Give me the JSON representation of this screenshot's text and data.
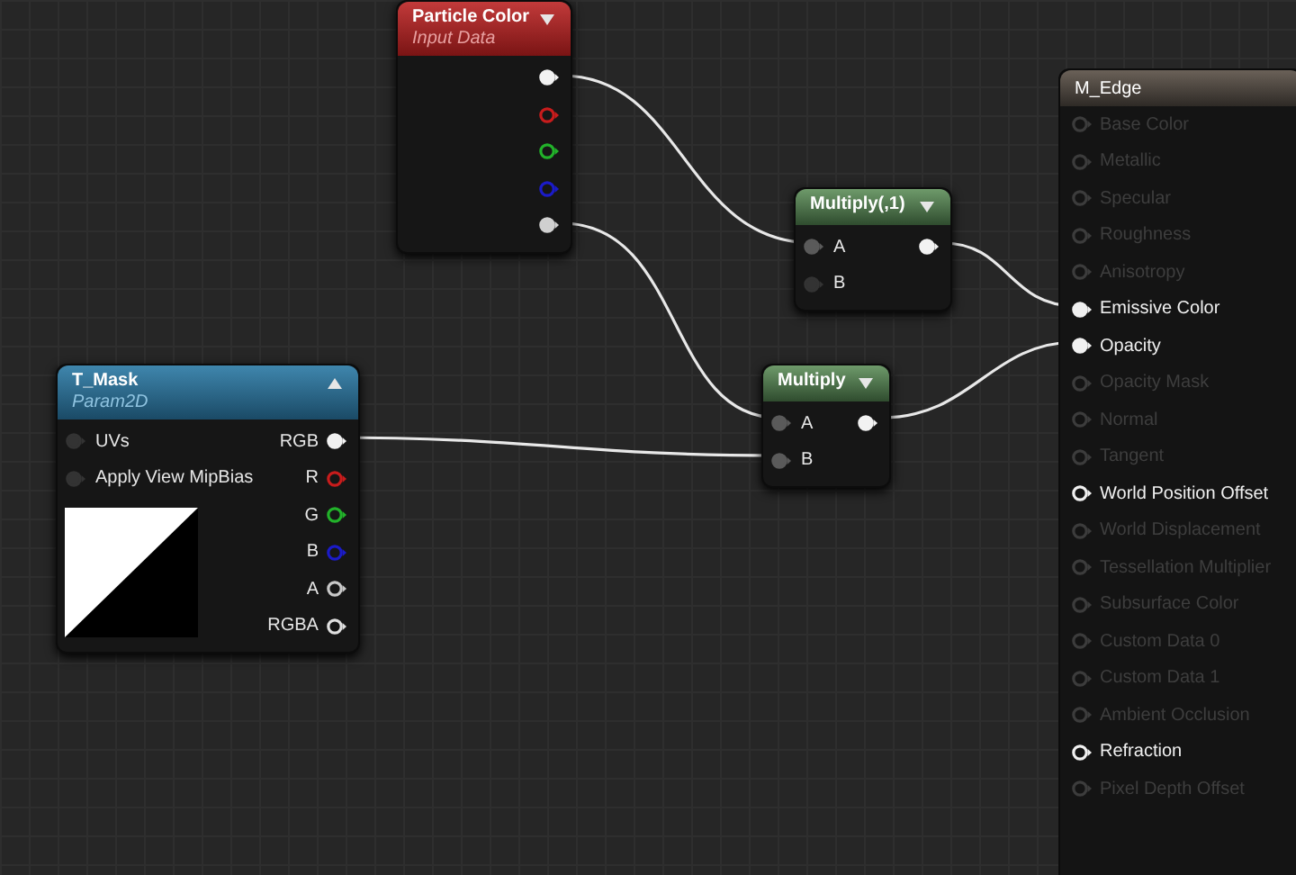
{
  "nodes": [
    {
      "kind": "particle",
      "title": "Particle Color",
      "subtitle": "Input Data",
      "preview_shown": false,
      "outputs": [
        {
          "color": "#f2f2f2",
          "connected": true
        },
        {
          "color": "#c81c1c",
          "connected": false
        },
        {
          "color": "#22b22a",
          "connected": false
        },
        {
          "color": "#1b1bc8",
          "connected": false
        },
        {
          "color": "#d0d0d0",
          "connected": true
        }
      ]
    },
    {
      "kind": "math",
      "title": "Multiply(,1)",
      "preview_shown": false,
      "inputs": [
        {
          "label": "A",
          "connected": true
        },
        {
          "label": "B",
          "connected": false
        }
      ],
      "outputs": [
        {
          "color": "#f2f2f2",
          "connected": true
        }
      ]
    },
    {
      "kind": "texture",
      "title": "T_Mask",
      "subtitle": "Param2D",
      "preview_shown": true,
      "inputs": [
        {
          "label": "UVs",
          "connected": false
        },
        {
          "label": "Apply View MipBias",
          "connected": false
        }
      ],
      "outputs": [
        {
          "label": "RGB",
          "color": "#f2f2f2",
          "connected": true
        },
        {
          "label": "R",
          "color": "#c81c1c",
          "connected": false
        },
        {
          "label": "G",
          "color": "#22b22a",
          "connected": false
        },
        {
          "label": "B",
          "color": "#1b1bc8",
          "connected": false
        },
        {
          "label": "A",
          "color": "#c8c8c8",
          "connected": false
        },
        {
          "label": "RGBA",
          "color": "#e0e0e0",
          "connected": false
        }
      ]
    },
    {
      "kind": "math",
      "title": "Multiply",
      "preview_shown": false,
      "inputs": [
        {
          "label": "A",
          "connected": true
        },
        {
          "label": "B",
          "connected": true
        }
      ],
      "outputs": [
        {
          "color": "#f2f2f2",
          "connected": true
        }
      ]
    }
  ],
  "material": {
    "title": "M_Edge",
    "inputs": [
      {
        "label": "Base Color",
        "enabled": false,
        "connected": false
      },
      {
        "label": "Metallic",
        "enabled": false,
        "connected": false
      },
      {
        "label": "Specular",
        "enabled": false,
        "connected": false
      },
      {
        "label": "Roughness",
        "enabled": false,
        "connected": false
      },
      {
        "label": "Anisotropy",
        "enabled": false,
        "connected": false
      },
      {
        "label": "Emissive Color",
        "enabled": true,
        "connected": true
      },
      {
        "label": "Opacity",
        "enabled": true,
        "connected": true
      },
      {
        "label": "Opacity Mask",
        "enabled": false,
        "connected": false
      },
      {
        "label": "Normal",
        "enabled": false,
        "connected": false
      },
      {
        "label": "Tangent",
        "enabled": false,
        "connected": false
      },
      {
        "label": "World Position Offset",
        "enabled": true,
        "connected": false
      },
      {
        "label": "World Displacement",
        "enabled": false,
        "connected": false
      },
      {
        "label": "Tessellation Multiplier",
        "enabled": false,
        "connected": false
      },
      {
        "label": "Subsurface Color",
        "enabled": false,
        "connected": false
      },
      {
        "label": "Custom Data 0",
        "enabled": false,
        "connected": false
      },
      {
        "label": "Custom Data 1",
        "enabled": false,
        "connected": false
      },
      {
        "label": "Ambient Occlusion",
        "enabled": false,
        "connected": false
      },
      {
        "label": "Refraction",
        "enabled": true,
        "connected": false
      },
      {
        "label": "Pixel Depth Offset",
        "enabled": false,
        "connected": false
      }
    ]
  }
}
